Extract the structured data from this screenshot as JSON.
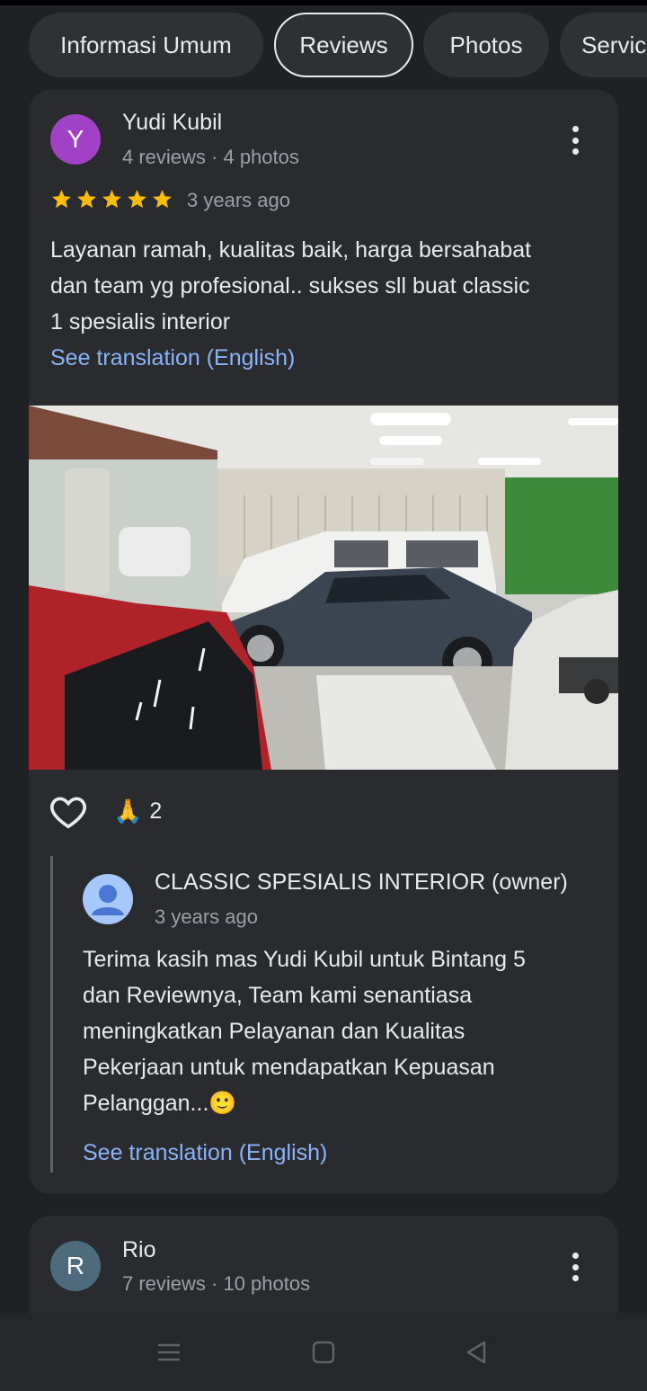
{
  "tabs": [
    {
      "label": "Informasi Umum",
      "active": false
    },
    {
      "label": "Reviews",
      "active": true
    },
    {
      "label": "Photos",
      "active": false
    },
    {
      "label": "Servic",
      "active": false
    }
  ],
  "reviews": [
    {
      "avatar_letter": "Y",
      "avatar_color": "#a142c6",
      "name": "Yudi Kubil",
      "meta": "4 reviews · 4 photos",
      "rating": 5,
      "time": "3 years ago",
      "text_lines": [
        "Layanan ramah, kualitas baik, harga bersahabat",
        "dan team yg profesional.. sukses sll buat classic",
        "1 spesialis interior"
      ],
      "translate_link": "See translation (English)",
      "reaction_emoji": "🙏",
      "reaction_count": "2",
      "reply": {
        "owner_name": "CLASSIC SPESIALIS INTERIOR (owner)",
        "time": "3 years ago",
        "text_lines": [
          "Terima kasih mas Yudi Kubil untuk Bintang 5",
          "dan Reviewnya, Team kami senantiasa",
          "meningkatkan Pelayanan dan Kualitas",
          "Pekerjaan untuk mendapatkan Kepuasan",
          "Pelanggan...🙂"
        ],
        "translate_link": "See translation (English)"
      }
    },
    {
      "avatar_letter": "R",
      "avatar_color": "#4e6b7d",
      "name": "Rio",
      "meta": "7 reviews · 10 photos"
    }
  ],
  "icons": {
    "star": "star-icon",
    "heart": "heart-outline-icon",
    "more": "more-vert-icon",
    "owner_avatar": "person-avatar-icon",
    "nav": [
      "menu-icon",
      "home-square-icon",
      "back-triangle-icon"
    ]
  },
  "colors": {
    "background": "#202124",
    "card": "#2a2b2e",
    "link": "#8ab4f8",
    "star": "#fbbc04"
  }
}
